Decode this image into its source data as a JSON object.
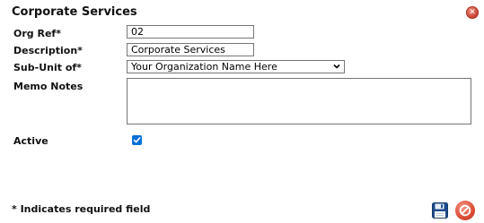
{
  "dialog": {
    "title": "Corporate Services",
    "close_icon": "close-icon"
  },
  "form": {
    "org_ref": {
      "label": "Org Ref*",
      "value": "02"
    },
    "description": {
      "label": "Description*",
      "value": "Corporate Services"
    },
    "sub_unit": {
      "label": "Sub-Unit of*",
      "selected": "Your Organization Name Here"
    },
    "memo_notes": {
      "label": "Memo Notes",
      "value": ""
    },
    "active": {
      "label": "Active",
      "checked": true
    }
  },
  "footer": {
    "required_note": "* Indicates required field",
    "save_icon": "floppy-disk-icon",
    "cancel_icon": "cancel-icon"
  },
  "colors": {
    "accent_blue": "#0a6fd6",
    "cancel_red": "#d9452f",
    "save_navy": "#1e4d8c"
  }
}
